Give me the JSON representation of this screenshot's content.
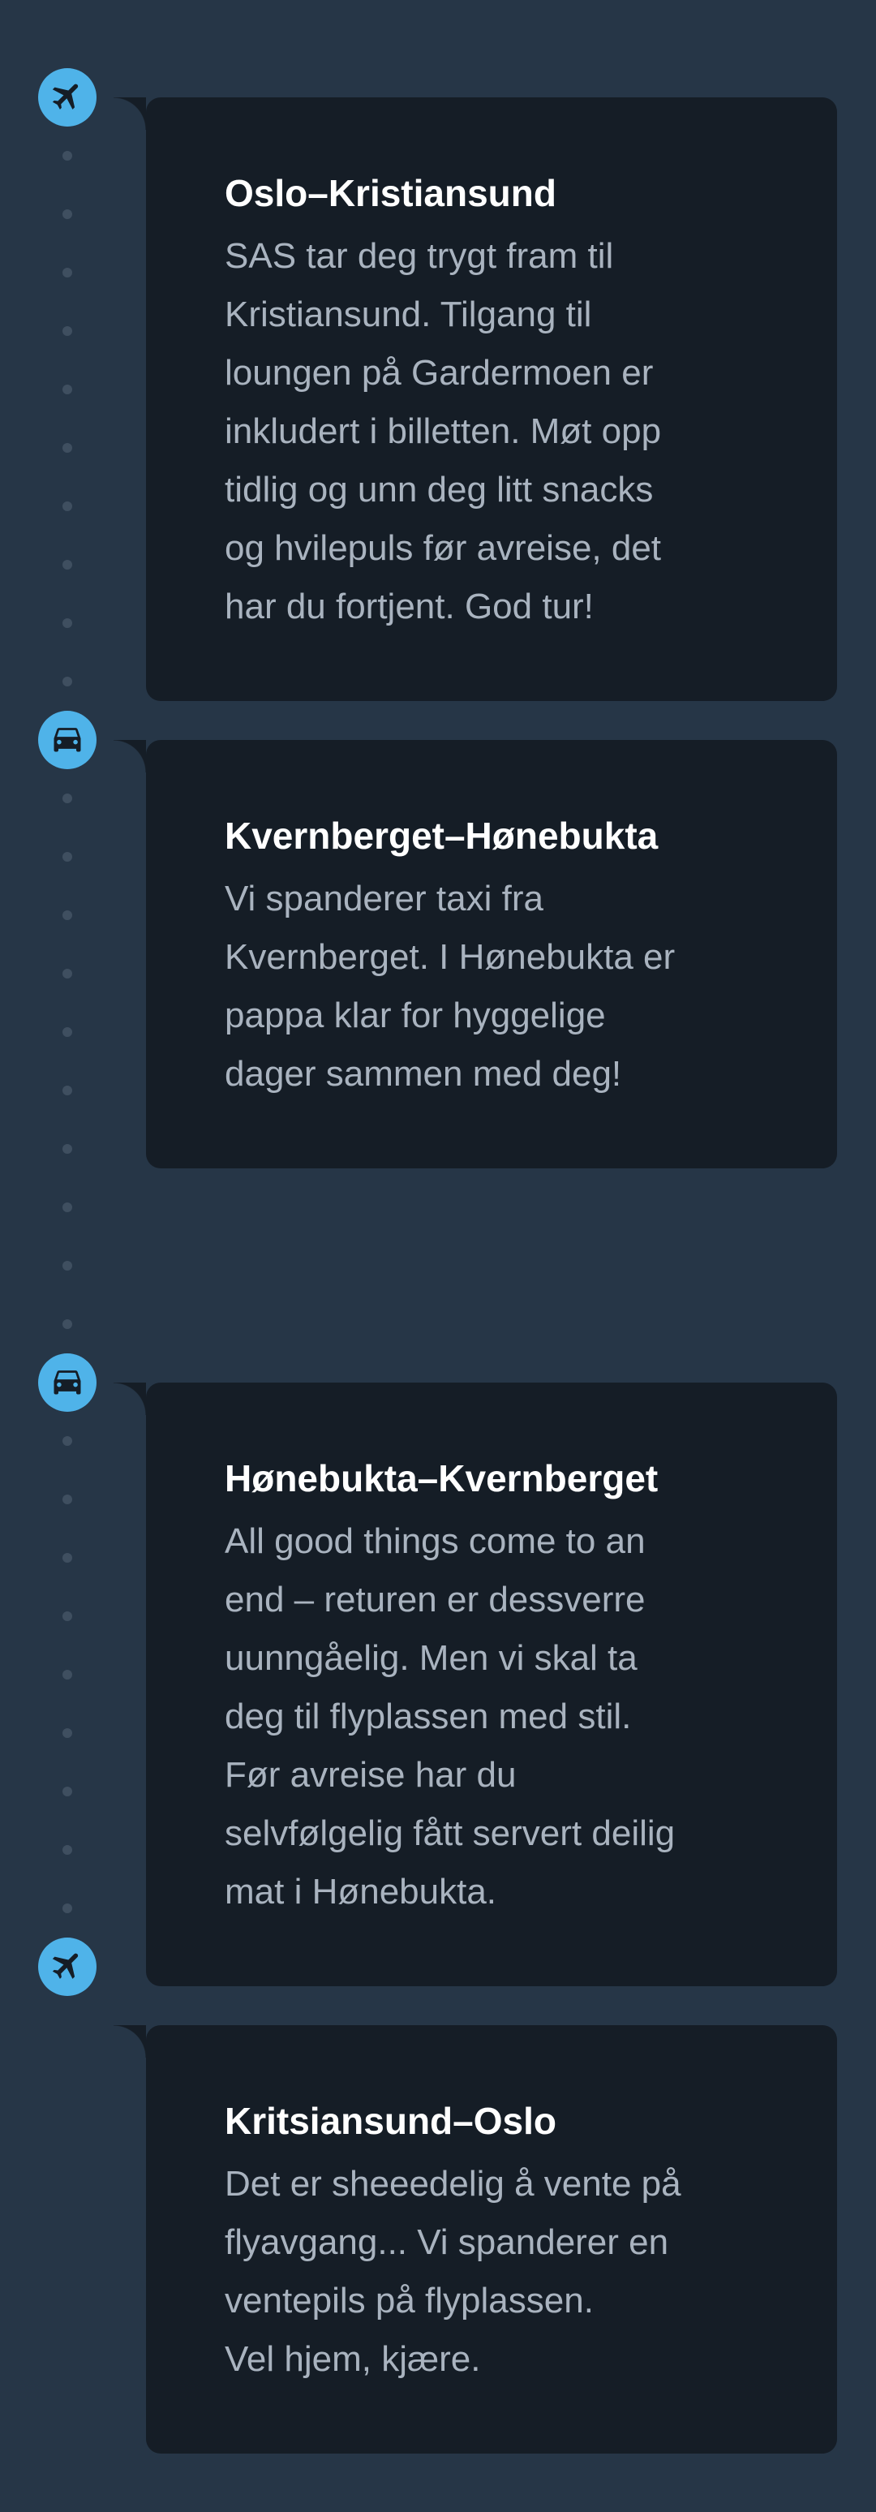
{
  "colors": {
    "background": "#263647",
    "card": "#151d26",
    "marker": "#4fb3e9",
    "title": "#ffffff",
    "body": "#a9b3bf",
    "dot": "#3f4f60"
  },
  "legs": [
    {
      "icon": "airplane-icon",
      "title": "Oslo–Kristiansund",
      "body": "SAS tar deg trygt fram til\nKristiansund. Tilgang til\nloungen på Gardermoen er\ninkludert i billetten. Møt opp\ntidlig og unn deg litt snacks\nog hvilepuls før avreise, det\nhar du fortjent. God tur!"
    },
    {
      "icon": "car-icon",
      "title": "Kvernberget–Hønebukta",
      "body": "Vi spanderer taxi fra\nKvernberget. I Hønebukta er\npappa klar for hyggelige\ndager sammen med deg!"
    },
    {
      "icon": "car-icon",
      "title": "Hønebukta–Kvernberget",
      "body": "All good things come to an\nend – returen er dessverre\nuunngåelig. Men vi skal ta\ndeg til flyplassen med stil.\nFør avreise har du\nselvfølgelig fått servert deilig\nmat i Hønebukta."
    },
    {
      "icon": "airplane-icon",
      "title": "Kritsiansund–Oslo",
      "body": "Det er sheeedelig å vente på\nflyavgang... Vi spanderer en\nventepils på flyplassen.\nVel hjem, kjære."
    }
  ]
}
